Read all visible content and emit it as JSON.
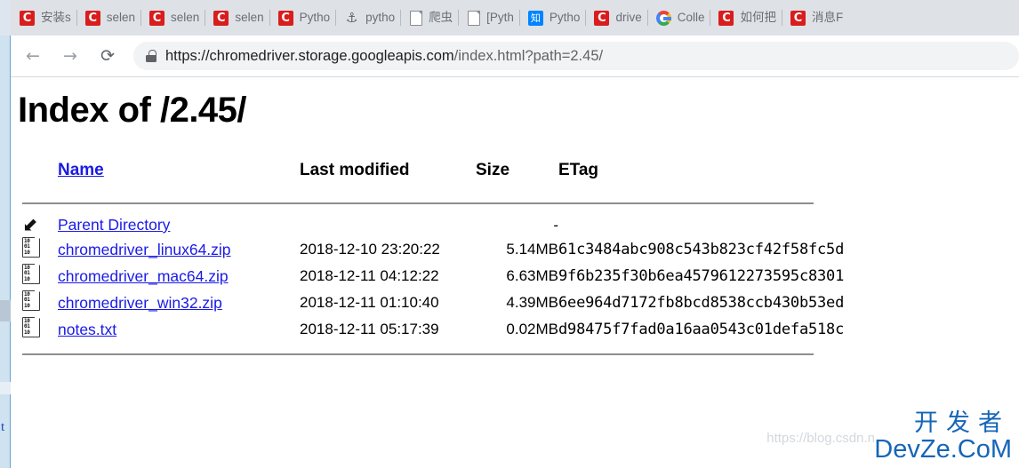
{
  "browser": {
    "tabs": [
      {
        "favicon": "csdn-icon",
        "label": "安装s"
      },
      {
        "favicon": "csdn-icon",
        "label": "selen"
      },
      {
        "favicon": "csdn-icon",
        "label": "selen"
      },
      {
        "favicon": "csdn-icon",
        "label": "selen"
      },
      {
        "favicon": "csdn-icon",
        "label": "Pytho"
      },
      {
        "favicon": "anchor-icon",
        "label": "pytho"
      },
      {
        "favicon": "document-icon",
        "label": "爬虫"
      },
      {
        "favicon": "document-icon",
        "label": "[Pyth"
      },
      {
        "favicon": "zhihu-icon",
        "label": "Pytho"
      },
      {
        "favicon": "csdn-icon",
        "label": "drive"
      },
      {
        "favicon": "google-icon",
        "label": "Colle"
      },
      {
        "favicon": "csdn-icon",
        "label": "如何把"
      },
      {
        "favicon": "csdn-icon",
        "label": "消息F"
      }
    ],
    "toolbar": {
      "back_label": "←",
      "forward_label": "→",
      "reload_label": "⟳",
      "lock_icon": "lock-icon",
      "url_secure": "https://chromedriver.storage.googleapis.com",
      "url_path": "/index.html?path=2.45/"
    }
  },
  "page": {
    "title": "Index of /2.45/",
    "columns": {
      "name": "Name",
      "last_modified": "Last modified",
      "size": "Size",
      "etag": "ETag"
    },
    "rows": [
      {
        "icon": "parent-directory-icon",
        "icon_glyph": "⬋",
        "name": "Parent Directory",
        "last_modified": "",
        "size": "-",
        "etag": ""
      },
      {
        "icon": "binary-file-icon",
        "icon_glyph": "",
        "name": "chromedriver_linux64.zip",
        "last_modified": "2018-12-10 23:20:22",
        "size": "5.14MB",
        "etag": "61c3484abc908c543b823cf42f58fc5d"
      },
      {
        "icon": "binary-file-icon",
        "icon_glyph": "",
        "name": "chromedriver_mac64.zip",
        "last_modified": "2018-12-11 04:12:22",
        "size": "6.63MB",
        "etag": "9f6b235f30b6ea4579612273595c8301"
      },
      {
        "icon": "binary-file-icon",
        "icon_glyph": "",
        "name": "chromedriver_win32.zip",
        "last_modified": "2018-12-11 01:10:40",
        "size": "4.39MB",
        "etag": "6ee964d7172fb8bcd8538ccb430b53ed"
      },
      {
        "icon": "binary-file-icon",
        "icon_glyph": "",
        "name": "notes.txt",
        "last_modified": "2018-12-11 05:17:39",
        "size": "0.02MB",
        "etag": "d98475f7fad0a16aa0543c01defa518c"
      }
    ]
  },
  "watermark": {
    "source_url": "https://blog.csdn.n",
    "brand_cn": "开发者",
    "brand_en": "DevZe.CoM"
  },
  "background": {
    "stray_letter": "t"
  },
  "colors": {
    "link": "#1a1ae6",
    "tab_strip": "#dee1e6",
    "omnibox": "#f1f3f4",
    "brand": "#1565b8",
    "csdn_red": "#d91d1d",
    "zhihu_blue": "#0084ff"
  }
}
